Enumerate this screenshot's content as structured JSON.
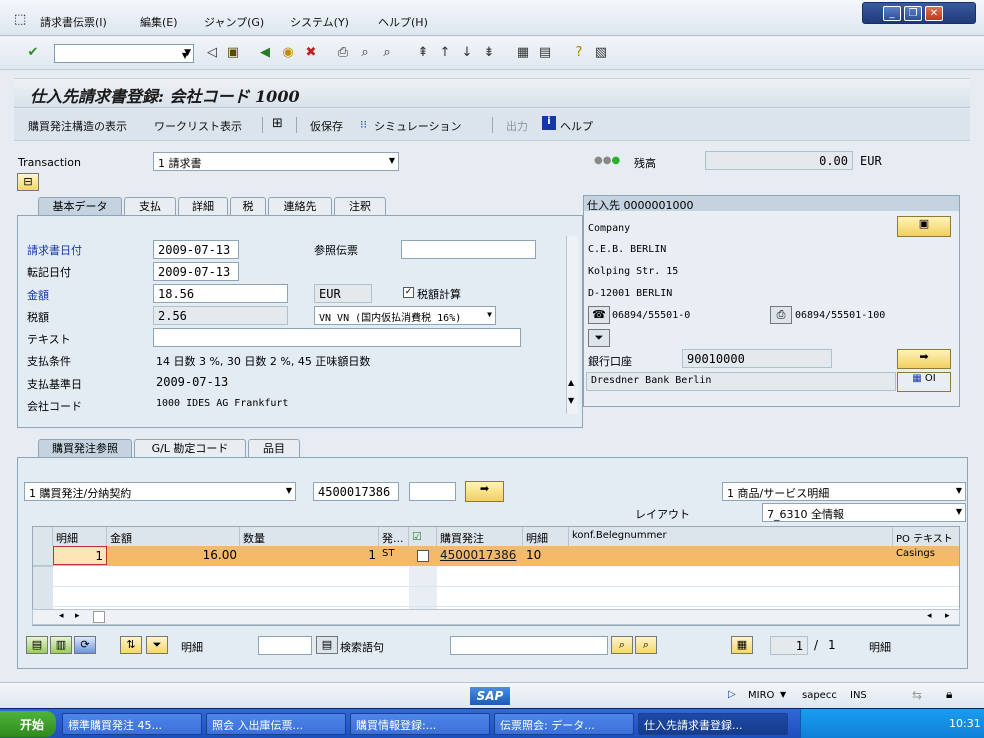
{
  "menubar": {
    "items": [
      "請求書伝票(I)",
      "編集(E)",
      "ジャンプ(G)",
      "システム(Y)",
      "ヘルプ(H)"
    ]
  },
  "title": "仕入先請求書登録: 会社コード 1000",
  "app_toolbar": {
    "po_structure": "購買発注構造の表示",
    "worklist": "ワークリスト表示",
    "park": "仮保存",
    "simulate": "シミュレーション",
    "output": "出力",
    "help": "ヘルプ"
  },
  "header": {
    "transaction_label": "Transaction",
    "transaction_value": "1 請求書",
    "balance_label": "残高",
    "balance_value": "0.00",
    "balance_currency": "EUR"
  },
  "tabs": [
    "基本データ",
    "支払",
    "詳細",
    "税",
    "連絡先",
    "注釈"
  ],
  "basic": {
    "invoice_date_label": "請求書日付",
    "invoice_date": "2009-07-13",
    "reference_label": "参照伝票",
    "reference": "",
    "posting_date_label": "転記日付",
    "posting_date": "2009-07-13",
    "amount_label": "金額",
    "amount": "18.56",
    "currency": "EUR",
    "calc_tax_label": "税額計算",
    "tax_amount_label": "税額",
    "tax_amount": "2.56",
    "tax_code": "VN VN (国内仮払消費税 16%)",
    "text_label": "テキスト",
    "text": "",
    "payment_terms_label": "支払条件",
    "payment_terms": "14 日数 3 %, 30 日数 2 %, 45 正味額日数",
    "baseline_date_label": "支払基準日",
    "baseline_date": "2009-07-13",
    "company_label": "会社コード",
    "company": "1000 IDES AG Frankfurt"
  },
  "vendor": {
    "header": "仕入先 0000001000",
    "line1": "Company",
    "line2": "C.E.B. BERLIN",
    "line3": "Kolping Str. 15",
    "line4": "D-12001 BERLIN",
    "phone": "06894/55501-0",
    "fax": "06894/55501-100",
    "bank_label": "銀行口座",
    "bank_account": "90010000",
    "bank_name": "Dresdner Bank Berlin",
    "oi_label": "OI"
  },
  "bottom_tabs": [
    "購買発注参照",
    "G/L 勘定コード",
    "品目"
  ],
  "po_ref": {
    "type": "1 購買発注/分納契約",
    "po_number": "4500017386",
    "item": "",
    "selection": "1 商品/サービス明細",
    "layout_label": "レイアウト",
    "layout": "7_6310 全情報"
  },
  "grid": {
    "columns": [
      "明細",
      "金額",
      "数量",
      "発...",
      "",
      "購買発注",
      "明細",
      "konf.Belegnummer",
      "PO テキスト"
    ],
    "rows": [
      {
        "item": "1",
        "amount": "16.00",
        "qty": "1",
        "unit": "ST",
        "po": "4500017386",
        "po_item": "10",
        "conf": "",
        "po_text": "Casings"
      }
    ]
  },
  "footer": {
    "item_label": "明細",
    "search_label": "検索語句",
    "page_current": "1",
    "page_sep": "/",
    "page_total": "1",
    "page_suffix": "明細"
  },
  "status": {
    "system": "MIRO",
    "server": "sapecc",
    "mode": "INS",
    "logo": "SAP"
  },
  "taskbar": {
    "start": "开始",
    "tasks": [
      "標準購買発注 45...",
      "照会 入出庫伝票...",
      "購買情報登録:...",
      "伝票照会: データ...",
      "仕入先請求書登録..."
    ],
    "clock": "10:31"
  },
  "colors": {
    "selected_row": "#f5b96a",
    "accent": "#1538a8"
  }
}
